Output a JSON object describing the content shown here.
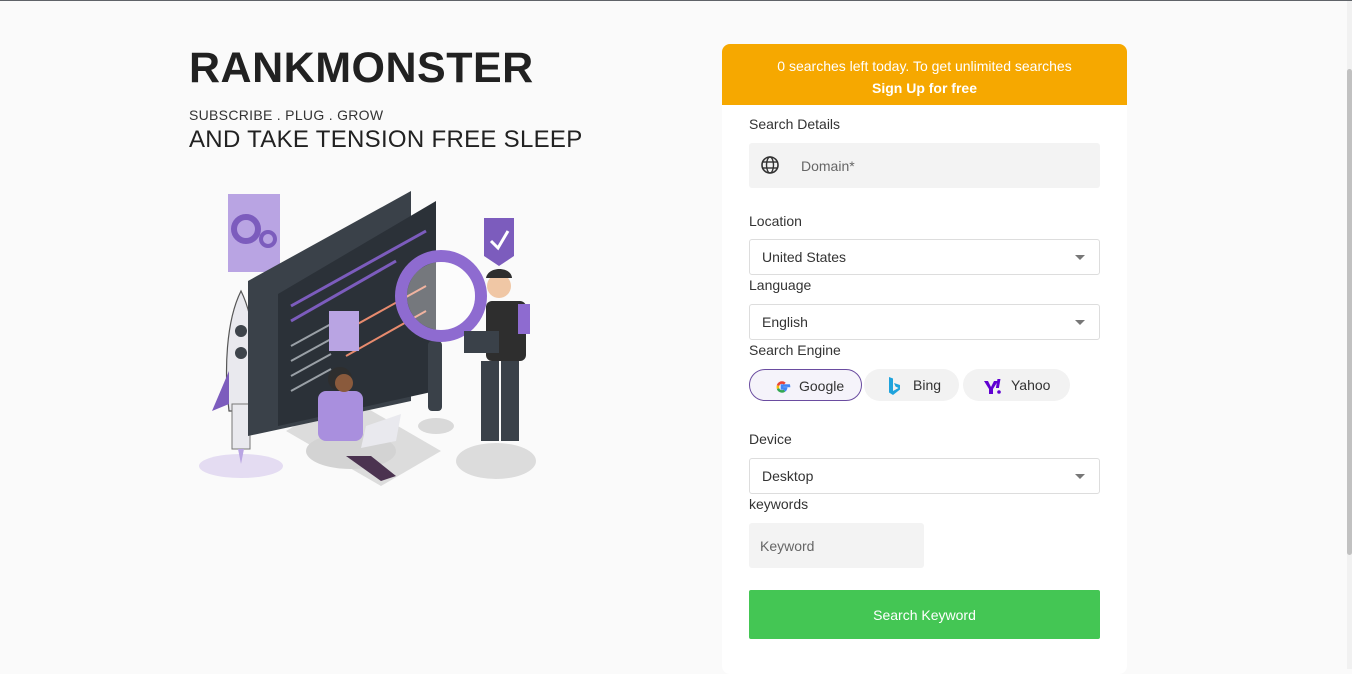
{
  "hero": {
    "brand": "RANKMONSTER",
    "tagline_small": "SUBSCRIBE . PLUG . GROW",
    "tagline_big": "AND TAKE TENSION FREE SLEEP"
  },
  "banner": {
    "message": "0 searches left today. To get unlimited searches",
    "link": "Sign Up for free",
    "color": "#f6a800"
  },
  "form": {
    "search_details_label": "Search Details",
    "domain_placeholder": "Domain*",
    "location_label": "Location",
    "location_value": "United States",
    "language_label": "Language",
    "language_value": "English",
    "engine_label": "Search Engine",
    "engines": [
      {
        "label": "Google",
        "icon": "google-icon",
        "selected": true
      },
      {
        "label": "Bing",
        "icon": "bing-icon",
        "selected": false
      },
      {
        "label": "Yahoo",
        "icon": "yahoo-icon",
        "selected": false
      }
    ],
    "device_label": "Device",
    "device_value": "Desktop",
    "keywords_label": "keywords",
    "keyword_placeholder": "Keyword",
    "submit_label": "Search Keyword",
    "submit_color": "#44c654",
    "accent_color": "#6a4ca0"
  }
}
